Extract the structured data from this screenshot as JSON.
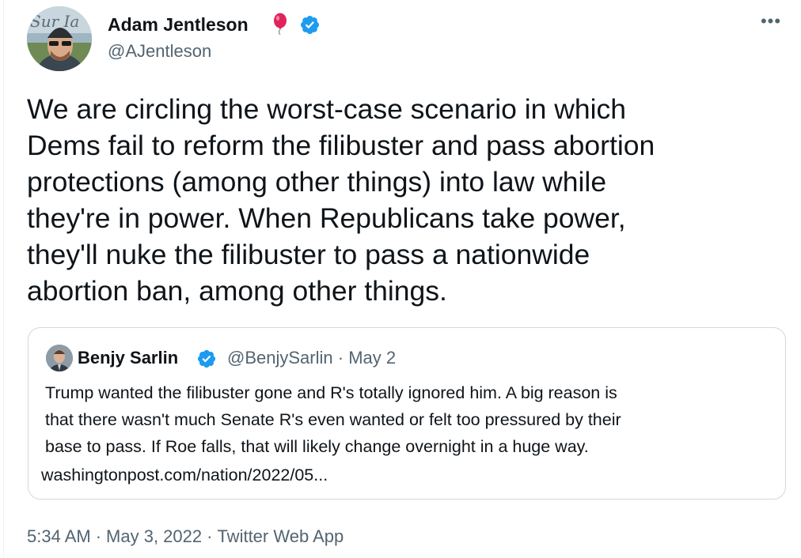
{
  "tweet": {
    "author": {
      "name": "Adam Jentleson",
      "handle": "@AJentleson",
      "avatar_icon": "avatar-photo-icon",
      "badge_icon": "balloon-emoji-icon",
      "verified_icon": "verified-badge-icon"
    },
    "more_label": "•••",
    "text_lines": [
      "We are circling the worst-case scenario in which",
      "Dems  fail to reform the filibuster and pass abortion",
      "protections (among other things) into law while",
      "they're in power. When Republicans take power,",
      "they'll nuke the filibuster to pass a nationwide",
      "abortion ban, among other things."
    ],
    "quoted": {
      "name": "Benjy Sarlin",
      "handle": "@BenjySarlin",
      "separator": "·",
      "date": "May 2",
      "text_lines": [
        "Trump wanted the filibuster gone and R's totally ignored him. A big reason is",
        "that there wasn't much Senate R's even wanted or felt too pressured by their",
        "base to pass. If Roe falls, that will likely change overnight in a huge way."
      ],
      "link": "washingtonpost.com/nation/2022/05..."
    },
    "meta": {
      "time": "5:34 AM",
      "separator": "·",
      "date": "May 3, 2022",
      "source": "Twitter Web App"
    },
    "colors": {
      "verified": "#1d9bf0",
      "secondary_text": "#536471",
      "border": "#cfd9de",
      "balloon": "#e0245e"
    }
  }
}
